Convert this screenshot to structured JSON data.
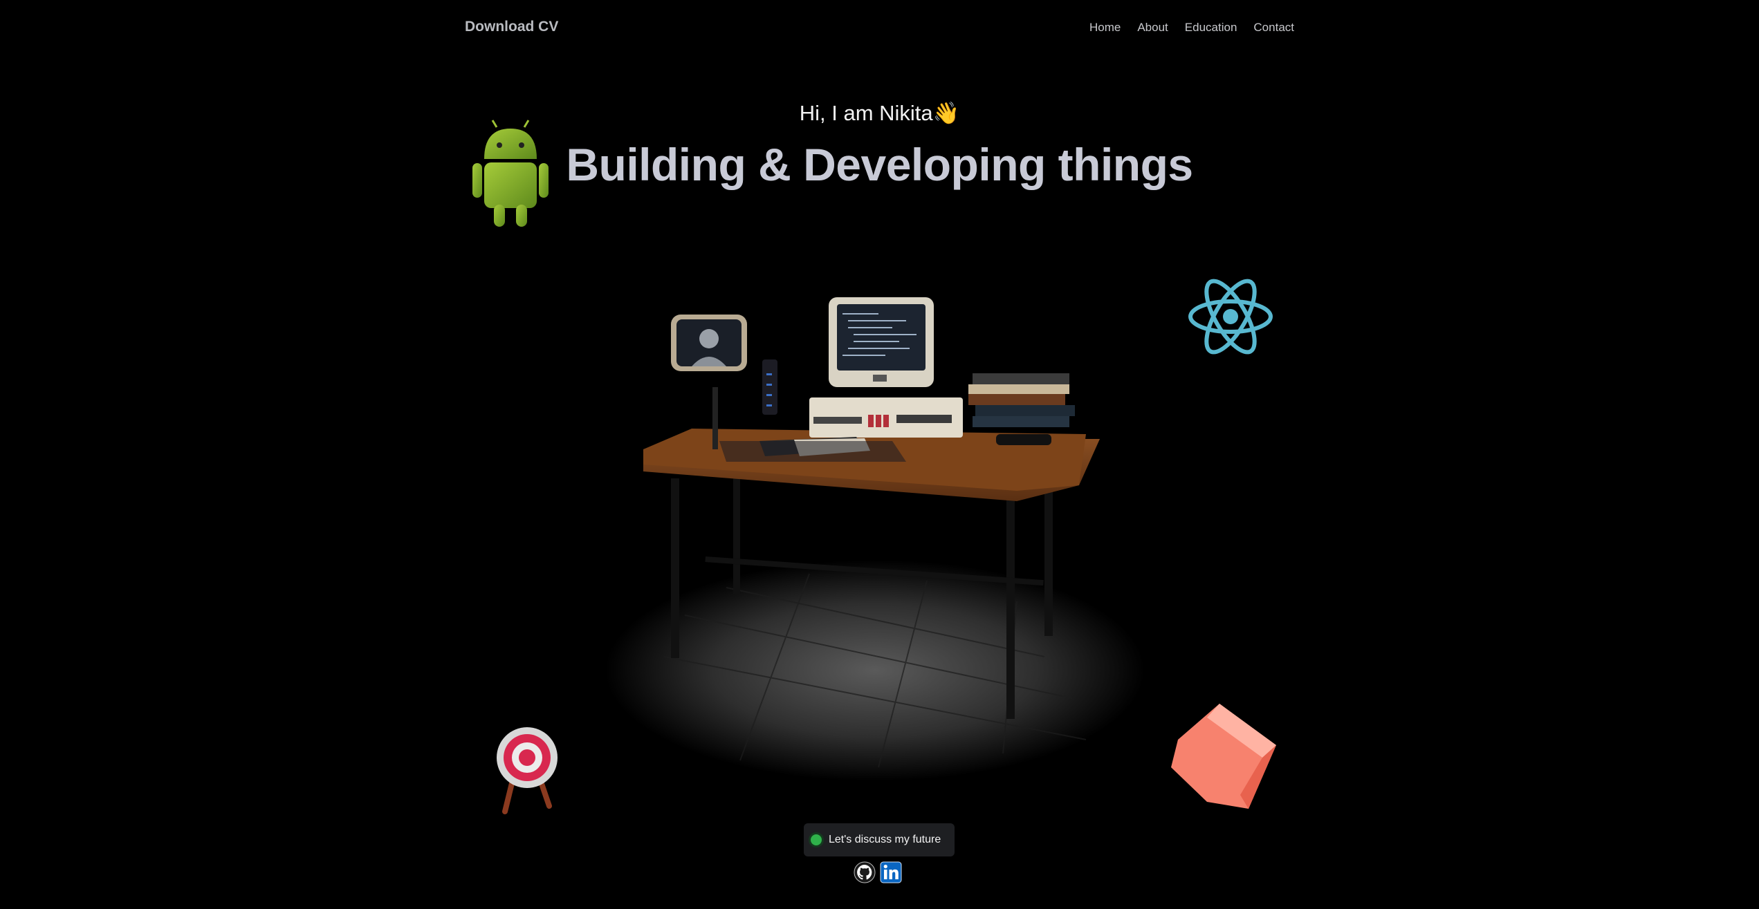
{
  "nav": {
    "brand": "Download CV",
    "links": [
      "Home",
      "About",
      "Education",
      "Contact"
    ]
  },
  "hero": {
    "greeting": "Hi, I am Nikita",
    "greeting_emoji": "👋",
    "headline": "Building & Developing things"
  },
  "cta": {
    "label": "Let's discuss my future",
    "status_color": "#2fb14a"
  },
  "social": {
    "icons": [
      "github-icon",
      "linkedin-icon"
    ]
  },
  "decorations": [
    "android-robot",
    "react-atom",
    "archery-target",
    "pink-cube",
    "computer-desk-scene"
  ],
  "colors": {
    "background": "#000000",
    "headline": "#c8cad6",
    "react": "#58b8d0",
    "android": "#8fb82e",
    "cube": "#f7826e",
    "linkedin": "#0a66c2"
  }
}
